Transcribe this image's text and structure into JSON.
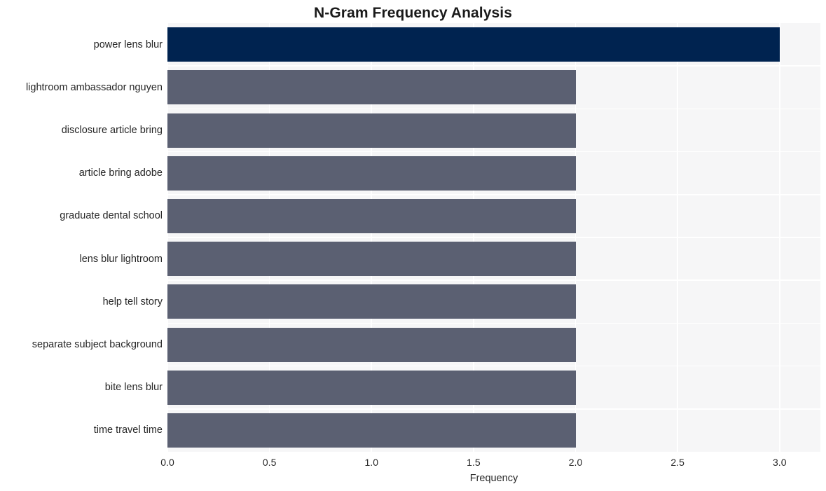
{
  "chart_data": {
    "type": "bar",
    "orientation": "horizontal",
    "title": "N-Gram Frequency Analysis",
    "xlabel": "Frequency",
    "ylabel": "",
    "xlim": [
      0,
      3.2
    ],
    "xticks": [
      "0.0",
      "0.5",
      "1.0",
      "1.5",
      "2.0",
      "2.5",
      "3.0"
    ],
    "xtick_values": [
      0.0,
      0.5,
      1.0,
      1.5,
      2.0,
      2.5,
      3.0
    ],
    "grid": true,
    "legend": null,
    "categories": [
      "power lens blur",
      "lightroom ambassador nguyen",
      "disclosure article bring",
      "article bring adobe",
      "graduate dental school",
      "lens blur lightroom",
      "help tell story",
      "separate subject background",
      "bite lens blur",
      "time travel time"
    ],
    "values": [
      3,
      2,
      2,
      2,
      2,
      2,
      2,
      2,
      2,
      2
    ],
    "bar_colors": [
      "#002350",
      "#5b6072",
      "#5b6072",
      "#5b6072",
      "#5b6072",
      "#5b6072",
      "#5b6072",
      "#5b6072",
      "#5b6072",
      "#5b6072"
    ],
    "plot_background": "#f6f6f7",
    "figure_background": "#ffffff",
    "gridline_color": "#ffffff",
    "highlight_color": "#002350",
    "bar_color": "#5b6072",
    "text_color": "#262626"
  }
}
